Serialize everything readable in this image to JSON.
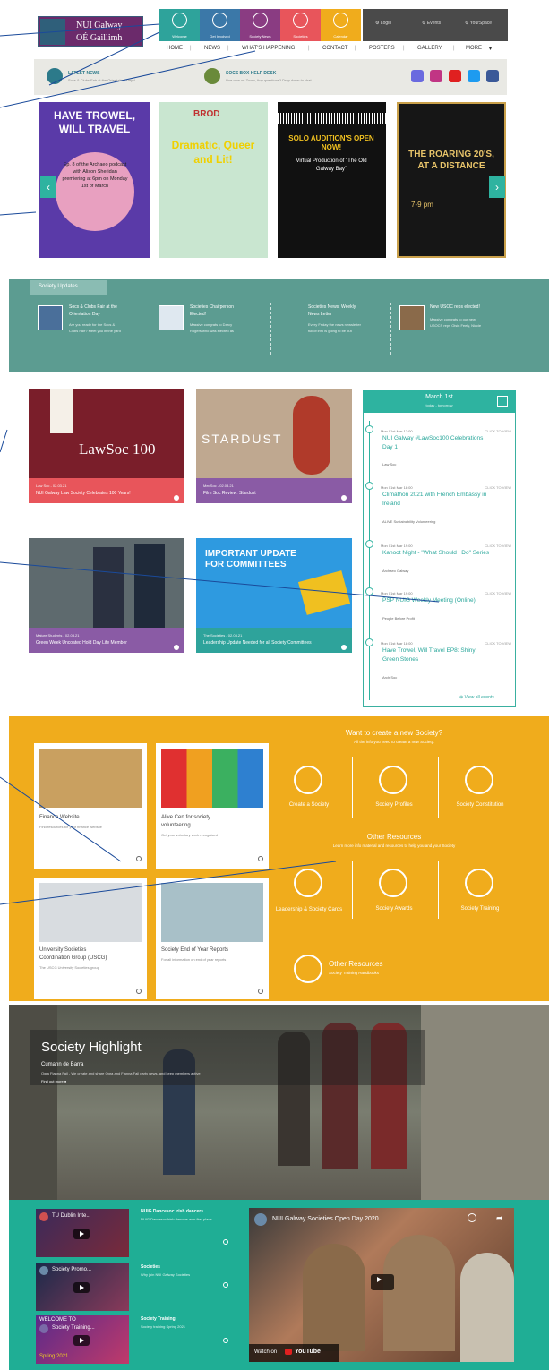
{
  "header": {
    "logo_line1": "NUI Galway",
    "logo_line2": "OÉ Gaillimh",
    "tiles": [
      {
        "label": "Welcome",
        "icon": "home-icon",
        "color": "#2ea39b"
      },
      {
        "label": "Get Involved",
        "icon": "people-icon",
        "color": "#3b78a8"
      },
      {
        "label": "Society News",
        "icon": "news-icon",
        "color": "#8a3c82"
      },
      {
        "label": "Societies",
        "icon": "crown-icon",
        "color": "#e8555b"
      },
      {
        "label": "Calendar",
        "icon": "calendar-icon",
        "color": "#f0ac1c"
      }
    ],
    "login": "Login",
    "events": "Events",
    "yourspace": "YourSpace"
  },
  "nav": [
    "HOME",
    "NEWS",
    "WHAT'S HAPPENING",
    "CONTACT",
    "POSTERS",
    "GALLERY",
    "MORE"
  ],
  "newsbar": {
    "latest_title": "LATEST NEWS",
    "latest_text": "Socs & Clubs Fair at the Orientation Days!",
    "helpdesk_title": "SOCS BOX HELP DESK",
    "helpdesk_text": "Live now on Zoom, Any questions? Drop down to chat"
  },
  "carousel": [
    {
      "title": "HAVE TROWEL, WILL TRAVEL",
      "body": "Ep. 8 of the Archaeo podcast with Alison Sheridan premiering at 6pm on Monday 1st of March"
    },
    {
      "title": "Dramatic, Queer and Lit!",
      "body": "BROD"
    },
    {
      "title": "SOLO AUDITION'S OPEN NOW!",
      "body": "Virtual Production of \"The Old Galway Bay\""
    },
    {
      "title": "THE ROARING 20'S, AT A DISTANCE",
      "body": "7-9 pm"
    }
  ],
  "updates": {
    "tab": "Society Updates",
    "items": [
      {
        "title": "Socs & Clubs Fair at the",
        "title2": "Orientation Day",
        "text": "Are you ready for the Socs &",
        "text2": "Clubs Fair? Meet you in the yard"
      },
      {
        "title": "Societies Chairperson",
        "title2": "Elected!",
        "text": "Massive congrats to Darcy",
        "text2": "Rogers who was elected as"
      },
      {
        "title": "Societies News: Weekly",
        "title2": "News Letter",
        "text": "Every Friday the news newsletter",
        "text2": "full of info is going to be out"
      },
      {
        "title": "New USOC reps elected!",
        "title2": "",
        "text": "Massive congrats to our new",
        "text2": "USOCS reps Oisin Feely, Niccie"
      }
    ]
  },
  "events_grid": [
    {
      "title": "LawSoc 100",
      "date": "Law Soc - 02.03.21",
      "desc": "NUI Galway Law Society Celebrates 100 Years!",
      "color": "#e8555b"
    },
    {
      "title": "STARDUST",
      "date": "MedSoc - 02.03.21",
      "desc": "Film Soc Review: Stardust",
      "color": "#8a5ba5"
    },
    {
      "title": "",
      "date": "Mature Students - 02.03.21",
      "desc": "Green Week Uncoated Hold Day Life Member",
      "color": "#8a5ba5"
    },
    {
      "title": "IMPORTANT UPDATE FOR COMMITTEES",
      "date": "The Societies - 02.03.21",
      "desc": "Leadership Update Needed for all Society Committees",
      "color": "#2ea39b"
    }
  ],
  "calendar": {
    "month": "March 1st",
    "sub": "today - tomorrow",
    "events": [
      {
        "date": "Mon 01st Mar 17:00",
        "more": "CLICK TO VIEW",
        "title": "NUI Galway #LawSoc100 Celebrations",
        "title2": "Day 1",
        "org": "Law Soc"
      },
      {
        "date": "Mon 01st Mar 18:00",
        "more": "CLICK TO VIEW",
        "title": "Climathon 2021 with French Embassy in",
        "title2": "Ireland",
        "org": "ALIVE Sustainability Volunteering"
      },
      {
        "date": "Mon 01st Mar 19:00",
        "more": "CLICK TO VIEW",
        "title": "Kahoot Night - \"What Should I Do\" Series",
        "title2": "",
        "org": "Archaeo Galway"
      },
      {
        "date": "Mon 01st Mar 19:00",
        "more": "CLICK TO VIEW",
        "title": "PSP NUIG Weekly Meeting (Online)",
        "title2": "",
        "org": "People Before Profit"
      },
      {
        "date": "Mon 01st Mar 18:00",
        "more": "CLICK TO VIEW",
        "title": "Have Trowel, Will Travel EP8: Shiny",
        "title2": "Green Stones",
        "org": "Arch Soc"
      }
    ],
    "view_all": "View all events"
  },
  "resources_cards": [
    {
      "title": "Finance Website",
      "desc": "Find resources for your finance website"
    },
    {
      "title": "Alive Cert for society",
      "title2": "volunteering",
      "desc": "Get your voluntary work recognised"
    },
    {
      "title": "University Societies",
      "title2": "Coordination Group (USCG)",
      "desc": "The USCG University Societies group"
    },
    {
      "title": "Society End of Year Reports",
      "desc": "For all information on end of year reports"
    }
  ],
  "create": {
    "heading": "Want to create a new Society?",
    "sub": "All the info you need to create a new Society.",
    "items": [
      "Create a Society",
      "Society Profiles",
      "Society Constitution"
    ],
    "other_heading": "Other Resources",
    "other_sub": "Learn more info material and resources to help you and your Society",
    "other_items": [
      "Leadership & Society Cards",
      "Society Awards",
      "Society Training"
    ],
    "more_title": "Other Resources",
    "more_sub": "Society Training Handbooks"
  },
  "highlight": {
    "title": "Society Highlight",
    "name": "Cumann de Barra",
    "text": "Ogra Fianna Fail - We create and share Ogra and Fianna Fail party news, and keep members active",
    "link": "Find out more"
  },
  "videos": {
    "items": [
      {
        "label": "TU Dublin Inte...",
        "title": "NUIG Dancesoc Irish dancers",
        "text": "NUIG Dancesoc Irish dancers won first place"
      },
      {
        "label": "Society Promo...",
        "title": "Societies",
        "text": "Why join NUI Galway Societies"
      },
      {
        "label": "Society Training...",
        "title": "Society Training",
        "text": "Society training Spring 2021"
      }
    ],
    "main_title": "NUI Galway Societies Open Day 2020",
    "watch": "Watch on",
    "youtube": "YouTube",
    "welcome": "WELCOME TO",
    "spring": "Spring 2021"
  }
}
